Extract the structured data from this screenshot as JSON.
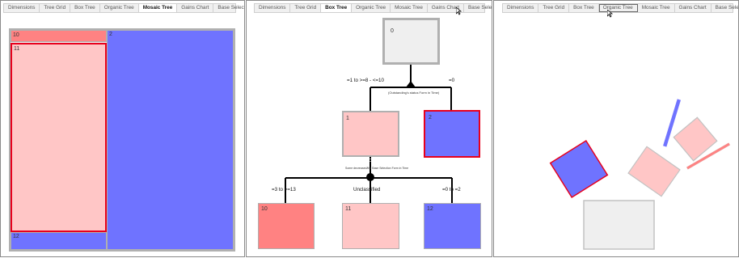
{
  "tabs": [
    "Dimensions",
    "Tree Grid",
    "Box Tree",
    "Organic Tree",
    "Mosaic Tree",
    "Gains Chart",
    "Base Selection"
  ],
  "panel1": {
    "active_tab": "Mosaic Tree",
    "nodes": {
      "n10": "10",
      "n2": "2",
      "n11": "11",
      "n12": "12"
    }
  },
  "panel2": {
    "active_tab": "Box Tree",
    "nodes": {
      "n0": "0",
      "n1": "1",
      "n2": "2",
      "n10": "10",
      "n11": "11",
      "n12": "12"
    },
    "branches": {
      "b1": "=1 to >=8 - <=10",
      "b0": "=0",
      "b3": "=3 to >=13",
      "bu": "Unclassified",
      "b02": "=0 to =2"
    },
    "split1_note": "(Outstanding's status Form in Time)",
    "split2_note": "Some decreased/the Base Selection Form in Time"
  },
  "panel3": {
    "active_tab": "Organic Tree"
  },
  "colors": {
    "salmon": "#ff8282",
    "pink": "#ffc6c6",
    "blue": "#6f73ff",
    "gray": "#efefef",
    "border_gray": "#b0b0b0",
    "red": "#e8001c"
  }
}
